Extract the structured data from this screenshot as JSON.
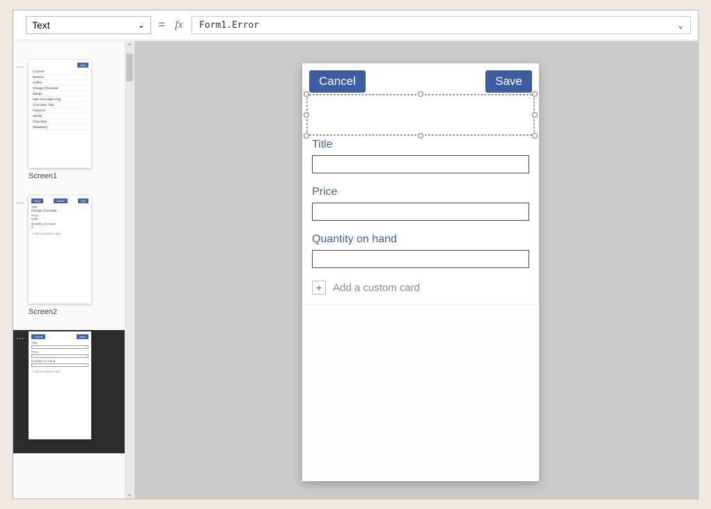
{
  "formula_bar": {
    "property": "Text",
    "equals": "=",
    "fx": "fx",
    "expression": "Form1.Error"
  },
  "thumbnails": {
    "screen1": {
      "label": "Screen1",
      "new_btn": "New",
      "items": [
        "Coconut",
        "Banana",
        "Coffee",
        "Orange Chocolate",
        "Mango",
        "Mint Chocolate Chip",
        "Chocolate Chip",
        "Pistachio",
        "Vanilla",
        "Chocolate",
        "Strawberry"
      ]
    },
    "screen2": {
      "label": "Screen2",
      "back_btn": "Back",
      "delete_btn": "Delete",
      "edit_btn": "Edit",
      "title_lbl": "Title",
      "title_val": "Orange Chocolate",
      "price_lbl": "Price",
      "price_val": "3.49",
      "qty_lbl": "Quantity on hand",
      "qty_val": "0",
      "add_custom": "+   Add a custom card"
    },
    "screen3": {
      "cancel_btn": "Cancel",
      "save_btn": "Save",
      "title_lbl": "Title",
      "price_lbl": "Price",
      "qty_lbl": "Quantity on hand",
      "add_custom": "+   Add a custom card"
    }
  },
  "canvas": {
    "cancel": "Cancel",
    "save": "Save",
    "fields": {
      "title": "Title",
      "price": "Price",
      "qty": "Quantity on hand"
    },
    "add_card": "Add a custom card"
  }
}
